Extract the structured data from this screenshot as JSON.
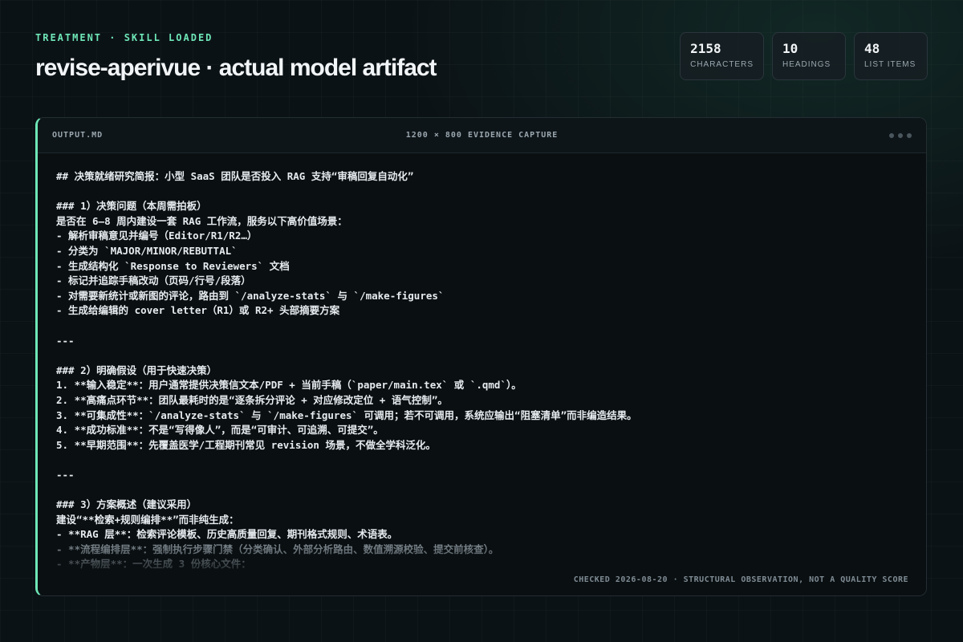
{
  "header": {
    "eyebrow": "TREATMENT · SKILL LOADED",
    "title": "revise-aperivue · actual model artifact"
  },
  "stats": [
    {
      "value": "2158",
      "label": "CHARACTERS"
    },
    {
      "value": "10",
      "label": "HEADINGS"
    },
    {
      "value": "48",
      "label": "LIST ITEMS"
    }
  ],
  "panel": {
    "filename": "OUTPUT.MD",
    "capture": "1200 × 800 EVIDENCE CAPTURE",
    "footnote": "CHECKED 2026-08-20 · STRUCTURAL OBSERVATION, NOT A QUALITY SCORE",
    "lines": [
      "## 决策就绪研究简报：小型 SaaS 团队是否投入 RAG 支持“审稿回复自动化”",
      "",
      "### 1）决策问题（本周需拍板）",
      "是否在 6–8 周内建设一套 RAG 工作流，服务以下高价值场景：",
      "- 解析审稿意见并编号（Editor/R1/R2…）",
      "- 分类为 `MAJOR/MINOR/REBUTTAL`",
      "- 生成结构化 `Response to Reviewers` 文档",
      "- 标记并追踪手稿改动（页码/行号/段落）",
      "- 对需要新统计或新图的评论，路由到 `/analyze-stats` 与 `/make-figures`",
      "- 生成给编辑的 cover letter（R1）或 R2+ 头部摘要方案",
      "",
      "---",
      "",
      "### 2）明确假设（用于快速决策）",
      "1. **输入稳定**：用户通常提供决策信文本/PDF + 当前手稿（`paper/main.tex` 或 `.qmd`）。",
      "2. **高痛点环节**：团队最耗时的是“逐条拆分评论 + 对应修改定位 + 语气控制”。",
      "3. **可集成性**：`/analyze-stats` 与 `/make-figures` 可调用；若不可调用，系统应输出“阻塞清单”而非编造结果。",
      "4. **成功标准**：不是“写得像人”，而是“可审计、可追溯、可提交”。",
      "5. **早期范围**：先覆盖医学/工程期刊常见 revision 场景，不做全学科泛化。",
      "",
      "---",
      "",
      "### 3）方案概述（建议采用）",
      "建设“**检索+规则编排**”而非纯生成：",
      "- **RAG 层**：检索评论模板、历史高质量回复、期刊格式规则、术语表。",
      "- **流程编排层**：强制执行步骤门禁（分类确认、外部分析路由、数值溯源校验、提交前核查）。",
      "- **产物层**：一次生成 3 份核心文件："
    ]
  }
}
